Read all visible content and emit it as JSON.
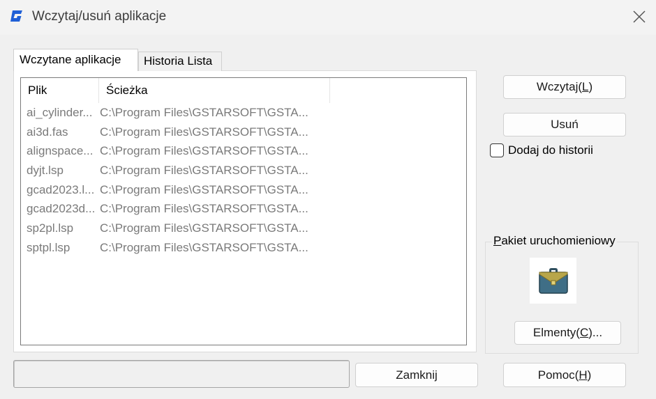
{
  "window": {
    "title": "Wczytaj/usuń aplikacje"
  },
  "tabs": [
    {
      "label": "Wczytane aplikacje",
      "active": true
    },
    {
      "label": "Historia Lista",
      "active": false
    }
  ],
  "list": {
    "columns": [
      "Plik",
      "Ścieżka"
    ],
    "rows": [
      {
        "file": "ai_cylinder...",
        "path": "C:\\Program Files\\GSTARSOFT\\GSTA..."
      },
      {
        "file": "ai3d.fas",
        "path": "C:\\Program Files\\GSTARSOFT\\GSTA..."
      },
      {
        "file": "alignspace...",
        "path": "C:\\Program Files\\GSTARSOFT\\GSTA..."
      },
      {
        "file": "dyjt.lsp",
        "path": "C:\\Program Files\\GSTARSOFT\\GSTA..."
      },
      {
        "file": "gcad2023.l...",
        "path": "C:\\Program Files\\GSTARSOFT\\GSTA..."
      },
      {
        "file": "gcad2023d...",
        "path": "C:\\Program Files\\GSTARSOFT\\GSTA..."
      },
      {
        "file": "sp2pl.lsp",
        "path": "C:\\Program Files\\GSTARSOFT\\GSTA..."
      },
      {
        "file": "sptpl.lsp",
        "path": "C:\\Program Files\\GSTARSOFT\\GSTA..."
      }
    ]
  },
  "buttons": {
    "load": {
      "text": "Wczytaj(",
      "key": "L",
      "end": ")"
    },
    "remove": "Usuń",
    "items": {
      "text": "Elmenty(",
      "key": "C",
      "end": ")..."
    },
    "close": "Zamknij",
    "help": {
      "text": "Pomoc(",
      "key": "H",
      "end": ")"
    }
  },
  "add_to_history": {
    "label": "Dodaj do historii",
    "checked": false
  },
  "startup_suite": {
    "label_key": "P",
    "label_rest": "akiet uruchomieniowy",
    "icon": "briefcase-icon"
  },
  "status_text": "",
  "colors": {
    "accent_icon": "#1f5fd6",
    "list_text": "#7a7a7a",
    "briefcase": "#3f6e86",
    "briefcase_flap": "#b8a64a"
  }
}
